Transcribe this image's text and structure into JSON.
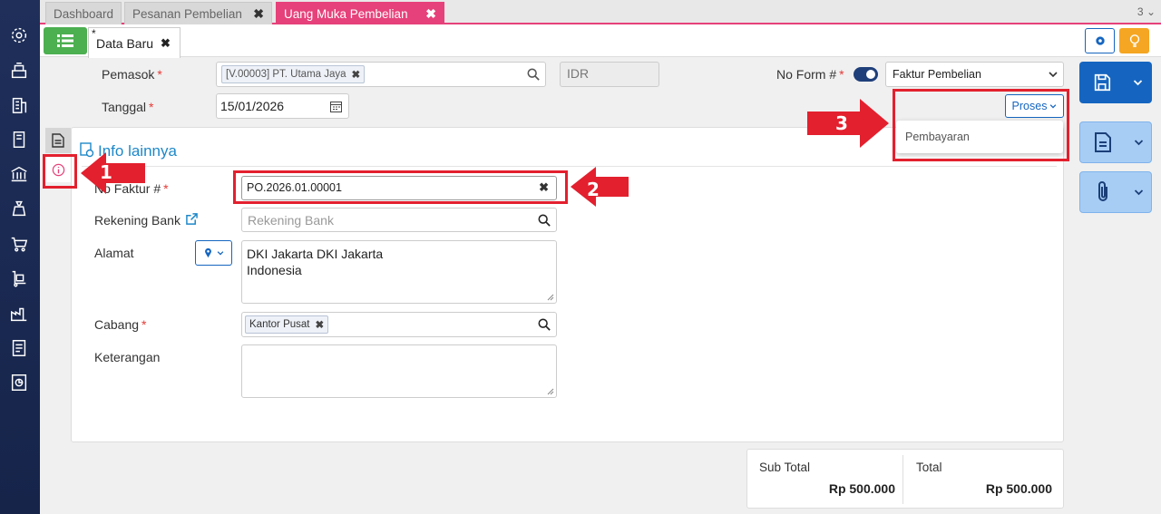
{
  "tabs": [
    {
      "label": "Dashboard",
      "closable": false
    },
    {
      "label": "Pesanan Pembelian",
      "closable": true
    },
    {
      "label": "Uang Muka Pembelian",
      "closable": true,
      "active": true
    }
  ],
  "tab_count": "3",
  "subtab": {
    "star": "*",
    "label": "Data Baru"
  },
  "form": {
    "pemasok_label": "Pemasok",
    "pemasok_value": "[V.00003] PT. Utama Jaya",
    "currency": "IDR",
    "noform_label": "No Form #",
    "faktur_type": "Faktur Pembelian",
    "tanggal_label": "Tanggal",
    "tanggal_value": "15/01/2026",
    "proses_label": "Proses",
    "menu_item": "Pembayaran"
  },
  "panel": {
    "title": "Info lainnya",
    "nofaktur_label": "No Faktur #",
    "nofaktur_value": "PO.2026.01.00001",
    "rekening_label": "Rekening Bank",
    "rekening_placeholder": "Rekening Bank",
    "alamat_label": "Alamat",
    "alamat_line1": "DKI Jakarta DKI Jakarta",
    "alamat_line2": "Indonesia",
    "cabang_label": "Cabang",
    "cabang_value": "Kantor Pusat",
    "keterangan_label": "Keterangan"
  },
  "totals": {
    "subtotal_label": "Sub Total",
    "subtotal_value": "Rp 500.000",
    "total_label": "Total",
    "total_value": "Rp 500.000"
  },
  "annotations": [
    "1",
    "2",
    "3"
  ],
  "colors": {
    "accent": "#e6417a",
    "primary": "#1565c0",
    "annotation": "#e3202e",
    "sidebar": "#1f2f5a"
  }
}
